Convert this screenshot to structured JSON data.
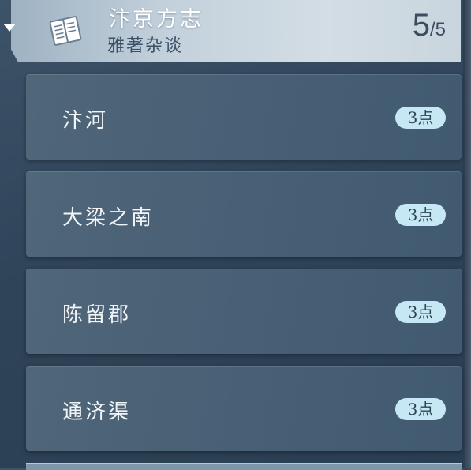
{
  "header": {
    "title": "汴京方志",
    "subtitle": "雅著杂谈",
    "progress_current": "5",
    "progress_separator": "/",
    "progress_total": "5",
    "icon": "book-icon",
    "collapse_icon": "triangle-down-icon"
  },
  "items": [
    {
      "label": "汴河",
      "badge": "3点"
    },
    {
      "label": "大梁之南",
      "badge": "3点"
    },
    {
      "label": "陈留郡",
      "badge": "3点"
    },
    {
      "label": "通济渠",
      "badge": "3点"
    }
  ],
  "colors": {
    "header_bg": "#c3d1dc",
    "item_bg": "#486075",
    "badge_bg": "#c6e8f4",
    "badge_text": "#2e4256"
  }
}
